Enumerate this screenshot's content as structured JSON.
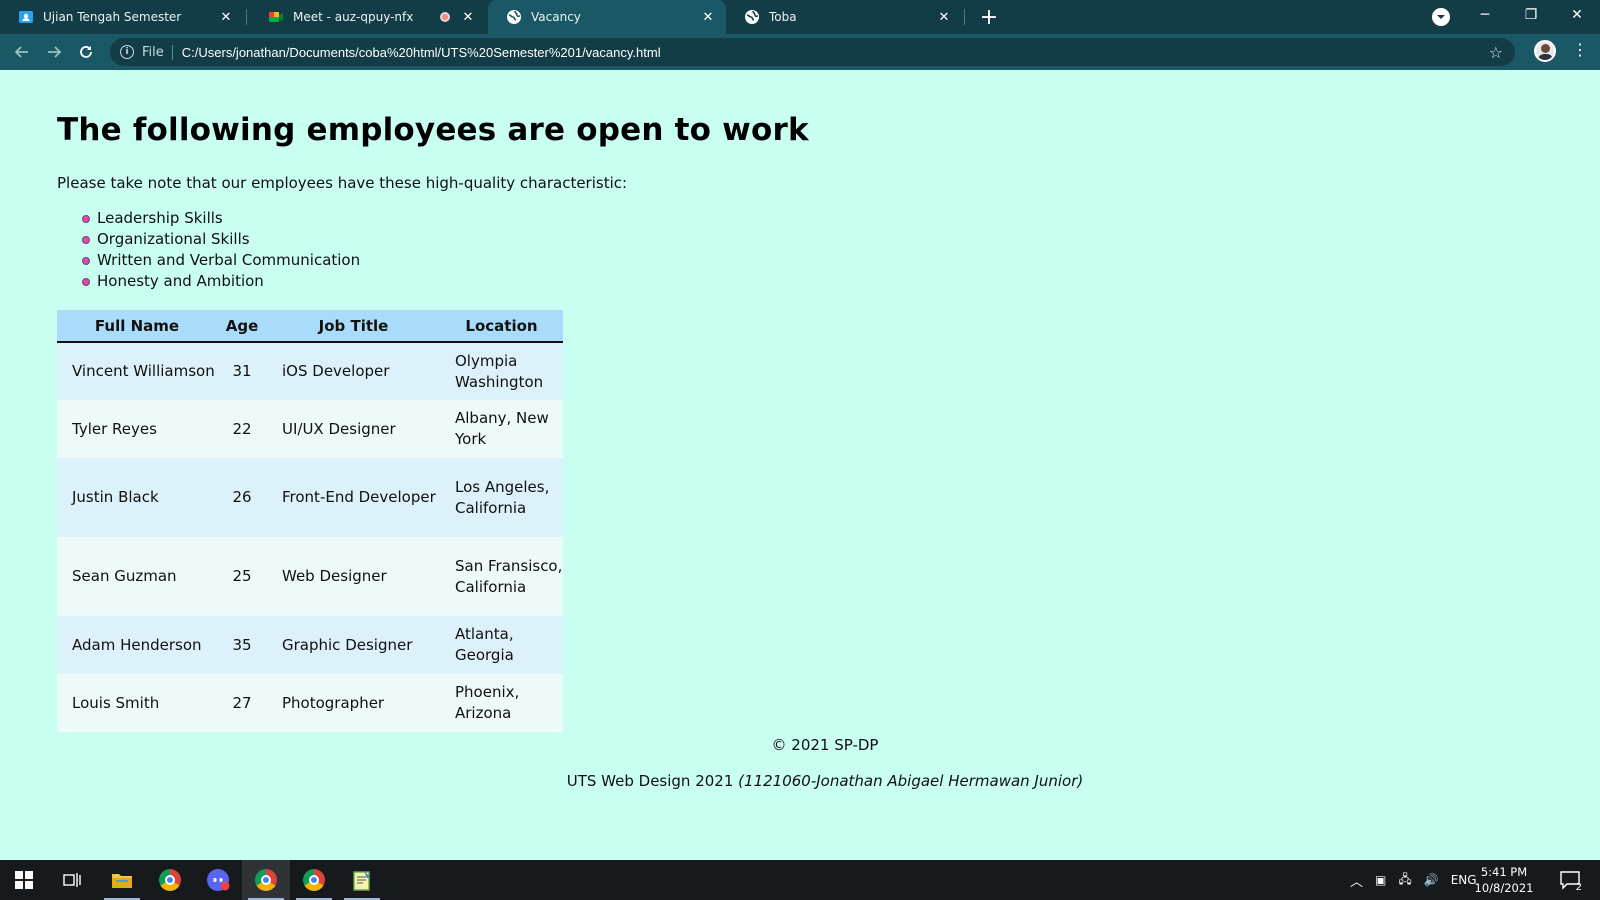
{
  "browser": {
    "tabs": [
      {
        "title": "Ujian Tengah Semester",
        "icon": "classroom-icon"
      },
      {
        "title": "Meet - auz-qpuy-nfx",
        "icon": "meet-icon",
        "recording": true
      },
      {
        "title": "Vacancy",
        "icon": "globe-icon",
        "active": true
      },
      {
        "title": "Toba",
        "icon": "globe-icon"
      }
    ],
    "scheme_label": "File",
    "url": "C:/Users/jonathan/Documents/coba%20html/UTS%20Semester%201/vacancy.html"
  },
  "page": {
    "heading": "The following employees are open to work",
    "intro": "Please take note that our employees have these high-quality characteristic:",
    "traits": [
      "Leadership Skills",
      "Organizational Skills",
      "Written and Verbal Communication",
      "Honesty and Ambition"
    ],
    "table": {
      "headers": [
        "Full Name",
        "Age",
        "Job Title",
        "Location"
      ],
      "rows": [
        {
          "name": "Vincent Williamson",
          "age": "31",
          "job": "iOS Developer",
          "location": "Olympia Washington"
        },
        {
          "name": "Tyler Reyes",
          "age": "22",
          "job": "UI/UX Designer",
          "location": "Albany, New York"
        },
        {
          "name": "Justin Black",
          "age": "26",
          "job": "Front-End Developer",
          "location": "Los Angeles, California"
        },
        {
          "name": "Sean Guzman",
          "age": "25",
          "job": "Web Designer",
          "location": "San Fransisco, California"
        },
        {
          "name": "Adam Henderson",
          "age": "35",
          "job": "Graphic Designer",
          "location": "Atlanta, Georgia"
        },
        {
          "name": "Louis Smith",
          "age": "27",
          "job": "Photographer",
          "location": "Phoenix, Arizona"
        }
      ]
    },
    "footer": {
      "copyright": "© 2021 SP-DP",
      "course": "UTS Web Design 2021",
      "author": "(1121060-Jonathan Abigael Hermawan Junior)"
    }
  },
  "taskbar": {
    "language": "ENG",
    "time": "5:41 PM",
    "date": "10/8/2021",
    "notification_count": "2"
  },
  "colors": {
    "page_bg": "#c9fff0",
    "table_header": "#a9dcfb",
    "row_odd": "#dcf1f9",
    "row_even": "#edfaf9",
    "chrome_dark": "#123c46",
    "chrome_active": "#1b5866"
  }
}
